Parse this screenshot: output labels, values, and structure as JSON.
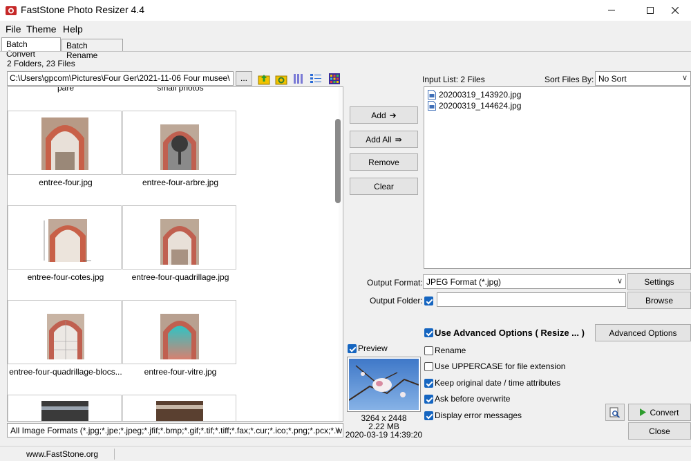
{
  "window": {
    "title": "FastStone Photo Resizer 4.4"
  },
  "menu": {
    "items": [
      "File",
      "Theme",
      "Help"
    ]
  },
  "tabs": [
    "Batch Convert",
    "Batch Rename"
  ],
  "browser": {
    "summary": "2 Folders, 23 Files",
    "path": "C:\\Users\\gpcom\\Pictures\\Four Ger\\2021-11-06 Four musee\\",
    "browse_label": "...",
    "top_partial_labels": [
      "pare",
      "small photos"
    ],
    "thumbnails": [
      {
        "name": "entree-four.jpg"
      },
      {
        "name": "entree-four-arbre.jpg"
      },
      {
        "name": "entree-four-cotes.jpg"
      },
      {
        "name": "entree-four-quadrillage.jpg"
      },
      {
        "name": "entree-four-quadrillage-blocs..."
      },
      {
        "name": "entree-four-vitre.jpg"
      }
    ],
    "format_filter": "All Image Formats (*.jpg;*.jpe;*.jpeg;*.jfif;*.bmp;*.gif;*.tif;*.tiff;*.fax;*.cur;*.ico;*.png;*.pcx;*.w"
  },
  "actions": {
    "add": "Add",
    "add_all": "Add All",
    "remove": "Remove",
    "clear": "Clear"
  },
  "input_list": {
    "label": "Input List:  2 Files",
    "sort_label": "Sort Files By:",
    "sort_value": "No Sort",
    "files": [
      "20200319_143920.jpg",
      "20200319_144624.jpg"
    ]
  },
  "output": {
    "format_label": "Output Format:",
    "format_value": "JPEG Format (*.jpg)",
    "settings_label": "Settings",
    "folder_label": "Output Folder:",
    "folder_value": "",
    "browse_label": "Browse"
  },
  "options": {
    "advanced": {
      "label": "Use Advanced Options ( Resize ... )",
      "checked": true
    },
    "advanced_button": "Advanced Options",
    "rename": {
      "label": "Rename",
      "checked": false
    },
    "uppercase": {
      "label": "Use UPPERCASE for file extension",
      "checked": false
    },
    "keep_date": {
      "label": "Keep original date / time attributes",
      "checked": true
    },
    "ask_overwrite": {
      "label": "Ask before overwrite",
      "checked": true
    },
    "display_errors": {
      "label": "Display error messages",
      "checked": true
    }
  },
  "preview": {
    "label": "Preview",
    "checked": true,
    "dimensions": "3264 x 2448",
    "size": "2.22 MB",
    "date": "2020-03-19 14:39:20"
  },
  "buttons": {
    "convert": "Convert",
    "close": "Close"
  },
  "status": {
    "url": "www.FastStone.org"
  },
  "colors": {
    "accent": "#1565c0",
    "convert_arrow": "#2e9d2e"
  }
}
